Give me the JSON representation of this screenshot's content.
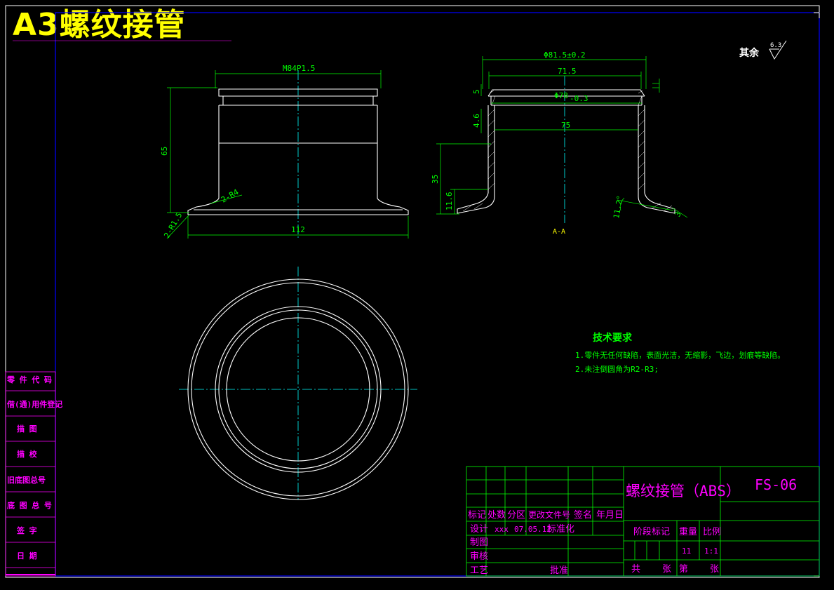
{
  "title": "A3螺纹接管",
  "roughness": {
    "label": "其余",
    "value": "6.3"
  },
  "front_view": {
    "thread_dim": "M84P1.5",
    "height_dim": "65",
    "flange_radius": "2-R4",
    "base_radius": "2-R1.5",
    "base_width_dim": "112"
  },
  "section_view": {
    "outer_dia": "Φ81.5±0.2",
    "width_71": "71.5",
    "inner_dia": "Φ78",
    "inner_dia_tol": "-0.3",
    "width_75": "75",
    "dim_5": "5",
    "dim_4_6": "4.6",
    "dim_35": "35",
    "dim_11_6": "11.6",
    "angle": "11.2°",
    "dim_3": "3",
    "section_label": "A-A"
  },
  "tech_req": {
    "title": "技术要求",
    "items": [
      "1.零件无任何缺陷，表面光洁，无缩影，飞边，划痕等缺陷。",
      "2.未注倒圆角为R2-R3;"
    ]
  },
  "sidebar": {
    "items": [
      "零 件 代 码",
      "借(通)用件登记",
      "描   图",
      "描   校",
      "旧底图总号",
      "底 图 总 号",
      "签   字",
      "日   期"
    ]
  },
  "title_block": {
    "part_name": "螺纹接管（ABS）",
    "drawing_no": "FS-06",
    "header_row": [
      "标记",
      "处数",
      "分区",
      "更改文件号",
      "签名",
      "年月日"
    ],
    "design_label": "设计",
    "design_name": "xxx",
    "design_date": "07.05.12",
    "standardize": "标准化",
    "drafting": "制图",
    "review": "审核",
    "process": "工艺",
    "approve": "批准",
    "stage_mark": "阶段标记",
    "weight": "重量",
    "scale": "比例",
    "weight_value": "11",
    "scale_value": "1:1",
    "total": "共",
    "sheets": "张",
    "sheet_no": "第",
    "sheets2": "张"
  },
  "colors": {
    "background": "#000000",
    "outline": "#ffffff",
    "dimension": "#00ff00",
    "centerline": "#00ffff",
    "border": "#0000ff",
    "table_text": "#ff00ff",
    "title": "#ffff00",
    "section_label": "#ffff00"
  }
}
